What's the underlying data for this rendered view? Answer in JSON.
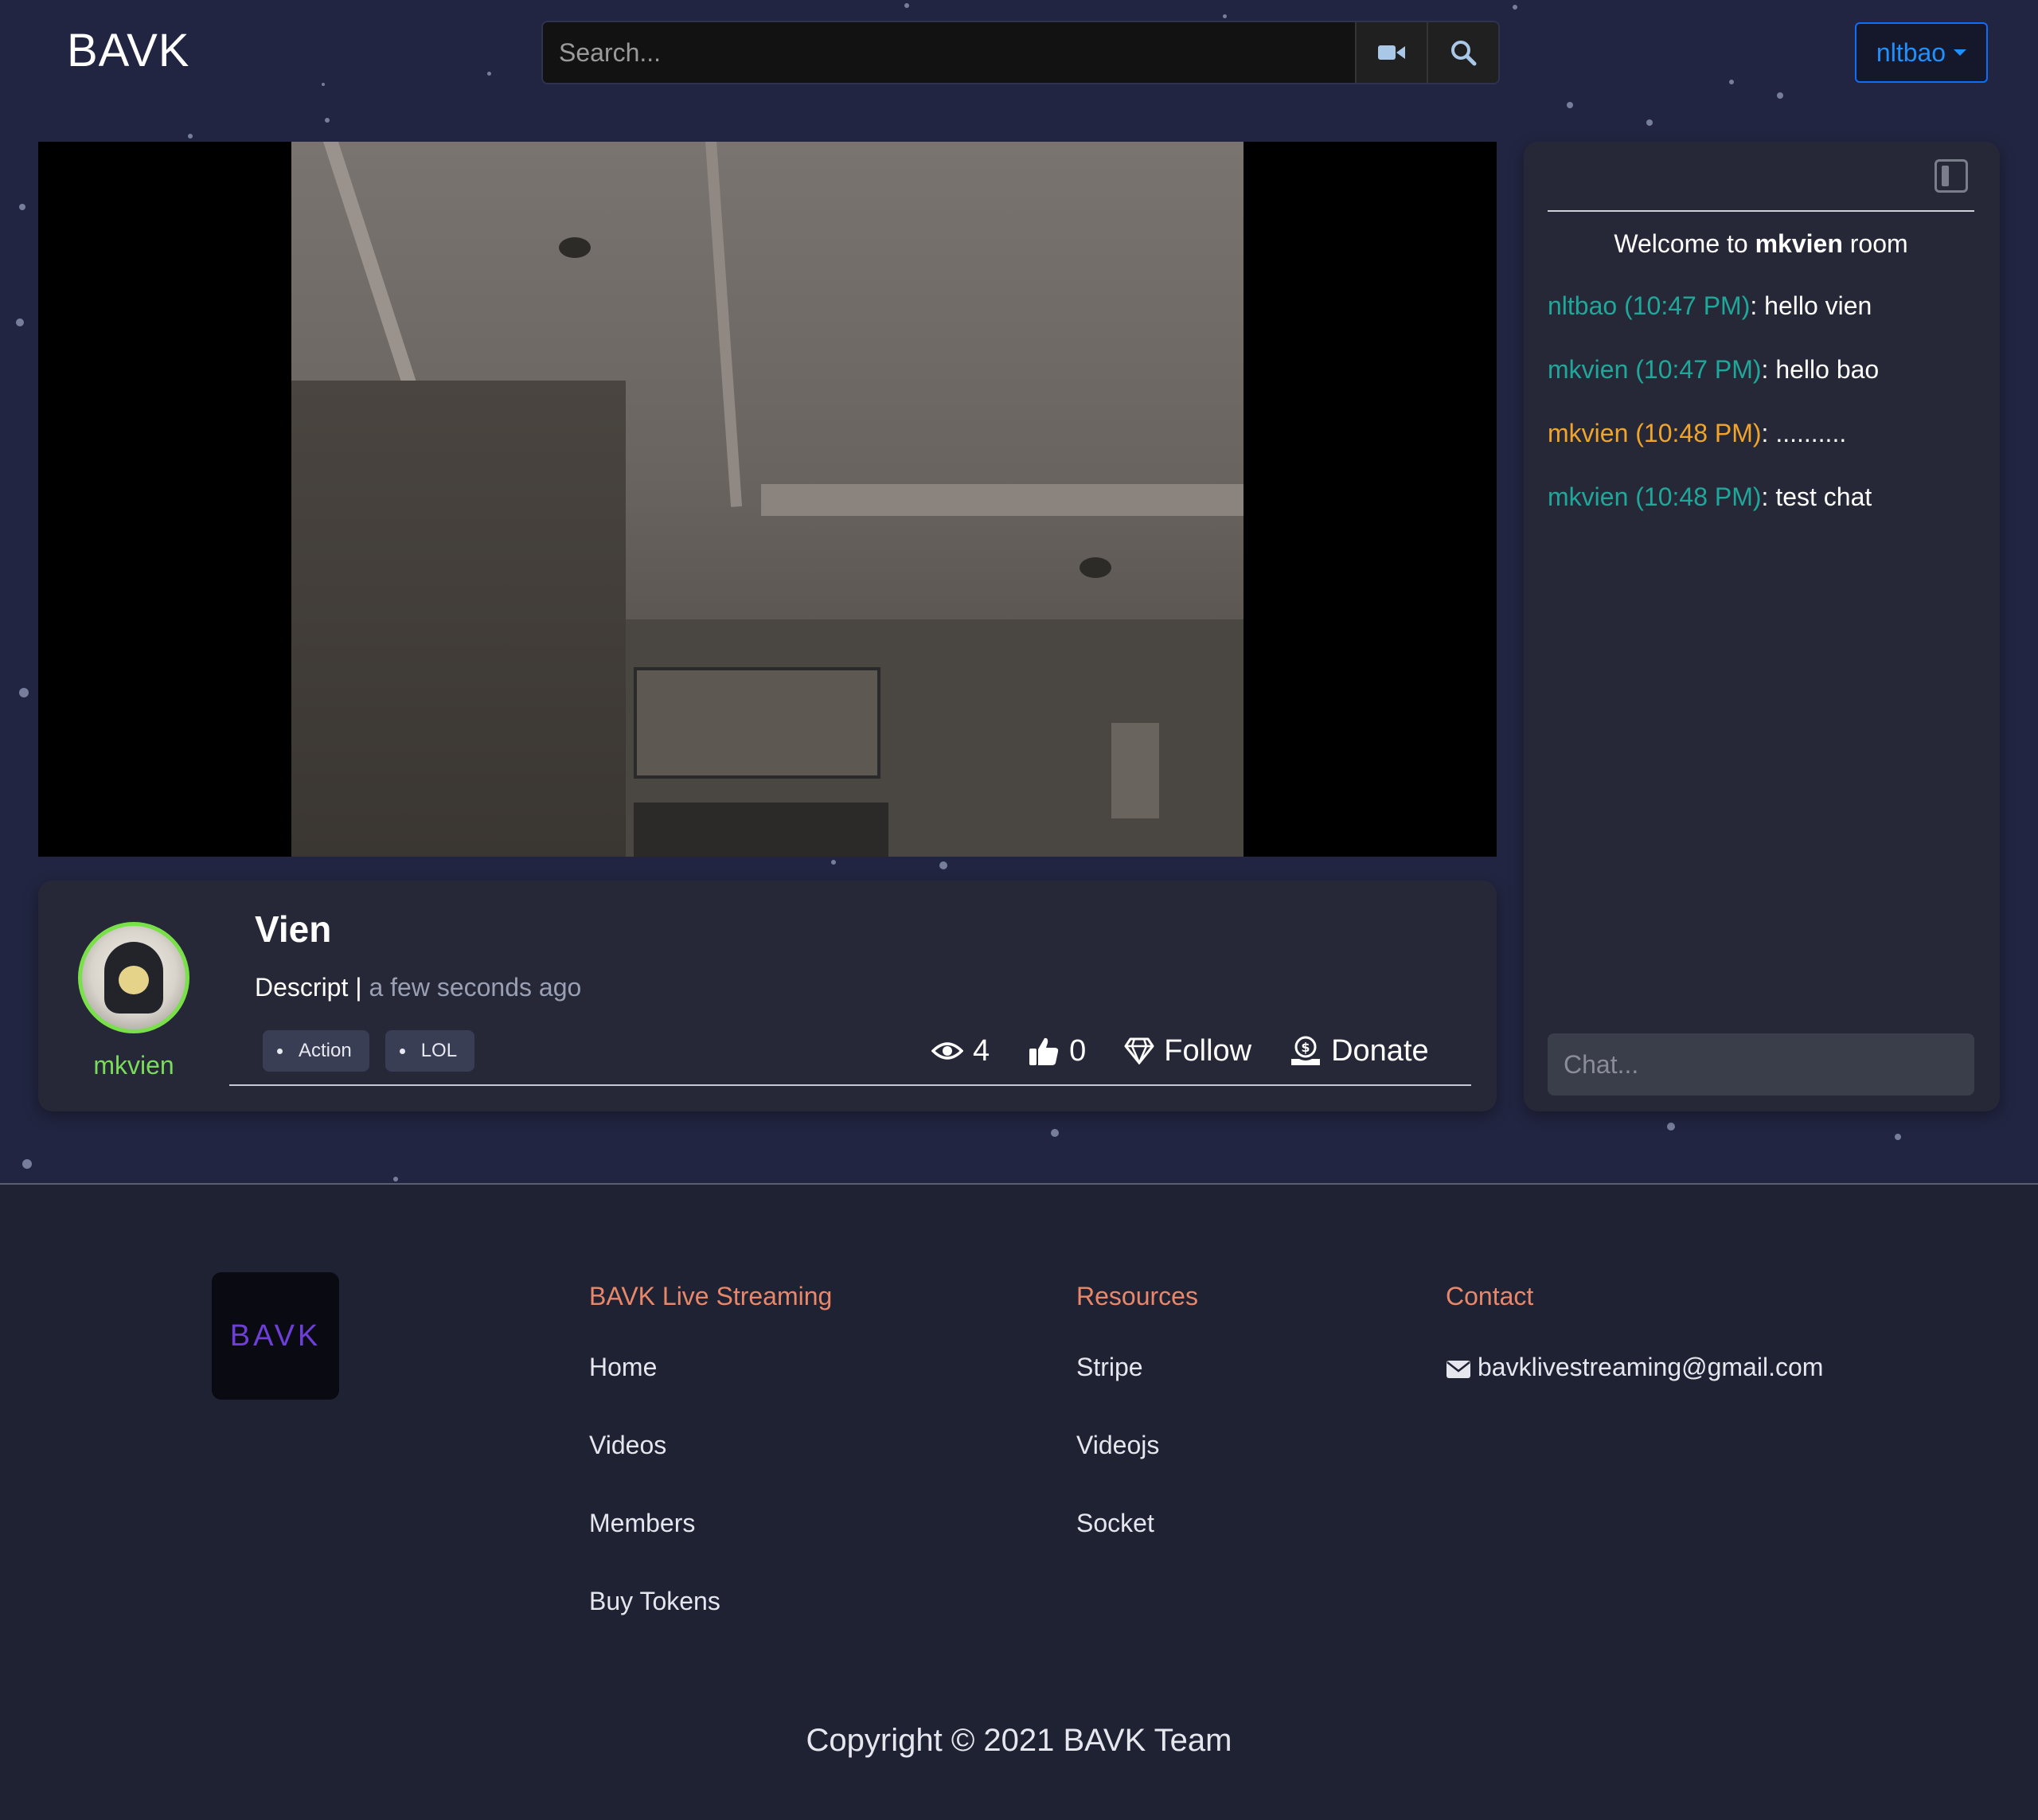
{
  "header": {
    "brand": "BAVK",
    "search_placeholder": "Search...",
    "user_menu_label": "nltbao"
  },
  "stream": {
    "title": "Vien",
    "description": "Descript",
    "separator": "|",
    "time_ago": "a few seconds ago",
    "streamer": "mkvien",
    "tags": [
      "Action",
      "LOL"
    ],
    "viewers": "4",
    "likes": "0",
    "follow_label": "Follow",
    "donate_label": "Donate"
  },
  "chat": {
    "welcome_prefix": "Welcome to",
    "welcome_user": "mkvien",
    "welcome_suffix": "room",
    "messages": [
      {
        "user": "nltbao (10:47 PM)",
        "text": ": hello vien",
        "color": "#1fa89a"
      },
      {
        "user": "mkvien (10:47 PM)",
        "text": ": hello bao",
        "color": "#1fa89a"
      },
      {
        "user": "mkvien (10:48 PM)",
        "text": ": ..........",
        "color": "#f0a52a"
      },
      {
        "user": "mkvien (10:48 PM)",
        "text": ": test chat",
        "color": "#1fa89a"
      }
    ],
    "input_placeholder": "Chat..."
  },
  "footer": {
    "logo_text": "BAVK",
    "columns": [
      {
        "heading": "BAVK Live Streaming",
        "links": [
          "Home",
          "Videos",
          "Members",
          "Buy Tokens"
        ]
      },
      {
        "heading": "Resources",
        "links": [
          "Stripe",
          "Videojs",
          "Socket"
        ]
      },
      {
        "heading": "Contact",
        "links": [
          "bavklivestreaming@gmail.com"
        ]
      }
    ],
    "copyright": "Copyright © 2021 BAVK Team"
  },
  "colors": {
    "accent": "#0d6efd",
    "streamer_name": "#7bdc5c",
    "footer_heading": "#e9876a",
    "chat_user": "#1fa89a",
    "chat_user_highlight": "#f0a52a"
  },
  "icons": {
    "video_search": "video-camera-icon",
    "search": "magnifier-icon",
    "views": "eye-icon",
    "likes": "thumbs-up-icon",
    "follow": "diamond-icon",
    "donate": "coin-hand-icon",
    "chat_toggle": "sidebar-toggle-icon",
    "email": "envelope-icon"
  }
}
